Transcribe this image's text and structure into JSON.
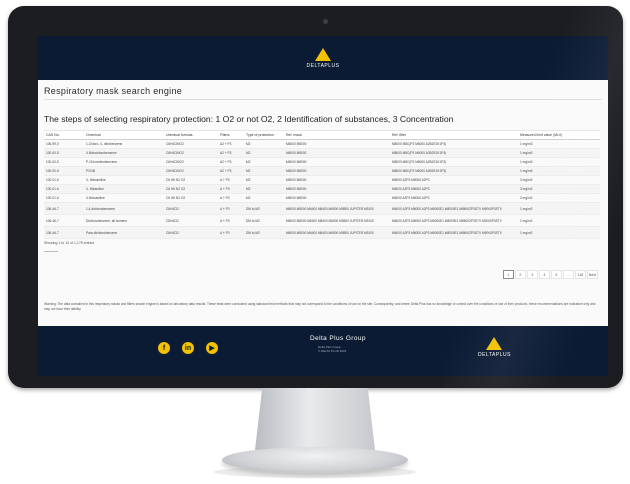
{
  "header": {
    "logo_text": "DELTAPLUS"
  },
  "page": {
    "title": "Respiratory mask search engine",
    "subtitle": "The steps of selecting respiratory protection: 1 O2 or not O2, 2 Identification of substances, 3 Concentration"
  },
  "table": {
    "columns": [
      "CAS No.",
      "Chemical",
      "chemical formula",
      "Filters",
      "Type of protection",
      "Ref. mask",
      "Ref. filter",
      "Measured limit value (MLV)"
    ],
    "rows": [
      [
        "106-99-0",
        "1-Chloro- 4- nitrobenzene",
        "C6H4ClNO2",
        "A2 + P3",
        "M2",
        "M6000 M8000",
        "M8000 M8C(P3 M6000 A2B2E1K1P3)",
        "1 mg/m3"
      ],
      [
        "100-00-5",
        "4-Nitrochlorobenzene",
        "C6H4ClNO2",
        "A2 + P3",
        "M2",
        "M6000 M8000",
        "M8000 M8C(P3 M6000 A2B2E1K1P3)",
        "1 mg/m3"
      ],
      [
        "100-00-5",
        "P-Chloronitrobenzene",
        "C6H4ClNO2",
        "A2 + P3",
        "M2",
        "M6000 M8000",
        "M8000 M8C(P3 M6000 A2B2E1K1P3)",
        "1 mg/m3"
      ],
      [
        "100-00-5",
        "PCNB",
        "C6H4ClNO2",
        "A2 + P3",
        "M2",
        "M6000 M8000",
        "M8000 M8C(P3 M6000 A2B2E1K1P3)",
        "1 mg/m3"
      ],
      [
        "100-01-6",
        "4- Nitroaniline",
        "C6 H6 N2 O2",
        "A + P3",
        "M2",
        "M6000 M8000",
        "M6000 A2P3 M8000 A2P3",
        "3 mg/m3"
      ],
      [
        "100-01-6",
        "4- Nitraniline",
        "C6 H6 N2 O2",
        "A + P3",
        "M2",
        "M6000 M8000",
        "M6000 A2P3 M8000 A2P3",
        "3 mg/m3"
      ],
      [
        "100-01-6",
        "4-Nitroaniline",
        "C6 H6 N2 O2",
        "A + P3",
        "M2",
        "M6000 M8000",
        "M6000 A2P3 M8000 A2P3",
        "3 mg/m3"
      ],
      [
        "106-46-7",
        "1,4-dichlorobenzene",
        "C6H4Cl2",
        "A + P3",
        "DM to M2",
        "M6000 M8000 M6400 M8400 M6500 M8500 JUPITER M9100",
        "M6000 A2P3 M8000 A2P3 M6000E1 M8000E1 M8600ZP3STV M9000P3STV",
        "1 mg/m3"
      ],
      [
        "106-46-7",
        "Dichlorobenzene, all isomers",
        "C6H4Cl2",
        "A + P3",
        "DM to M2",
        "M6000 M8000 M6400 M8400 M6500 M8500 JUPITER M9100",
        "M6000 A2P3 M8000 A2P3 M6000E1 M8000E1 M8600ZP3STV M9000P3STV",
        "1 mg/m3"
      ],
      [
        "106-46-7",
        "Para-dichlorobenzene",
        "C6H4Cl2",
        "A + P3",
        "DM to M2",
        "M6000 M8000 M6400 M8400 M6500 M8500 JUPITER M9100",
        "M6000 A2P3 M8000 A2P3 M6000E1 M8000E1 M8600ZP3STV M9000P3STV",
        "1 mg/m3"
      ]
    ]
  },
  "table_info": "Showing 1 to 10 of 1,178 entries",
  "pagination": [
    "1",
    "2",
    "3",
    "4",
    "5",
    "...",
    "118",
    "Next"
  ],
  "warning": "Warning: The data contained in this respiratory masks and filters search engine is based on laboratory data results. These tests were conducted using standard test methods that may not correspond to the conditions of use on the site. Consequently, and where Delta Plus has no knowledge or control over the conditions of use of their products, these recommendations are indicative only and may not incur their liability.",
  "footer": {
    "company": "Delta Plus Group",
    "sub1": "Delta Plus Group",
    "sub2": "© DELTA PLUS 2022",
    "logo_text": "DELTAPLUS",
    "social": [
      {
        "icon": "facebook-icon",
        "glyph": "f"
      },
      {
        "icon": "linkedin-icon",
        "glyph": "in"
      },
      {
        "icon": "youtube-icon",
        "glyph": "▶"
      }
    ]
  },
  "colors": {
    "navy": "#0b1b34",
    "yellow": "#f2c200"
  }
}
